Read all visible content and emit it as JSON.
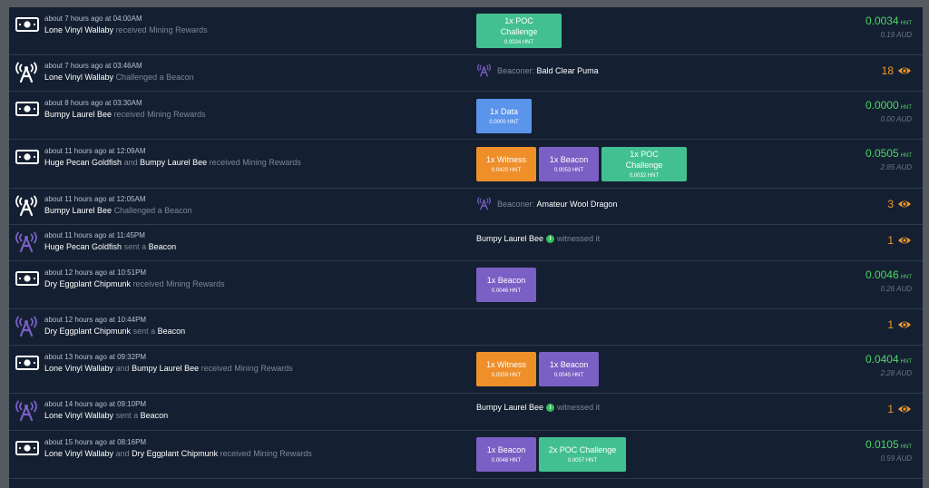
{
  "colors": {
    "poc": "#43c091",
    "data": "#5b94eb",
    "witness": "#ee8f2a",
    "beacon": "#7a5fc4",
    "hnt_green": "#4fd467",
    "count_orange": "#f0962a"
  },
  "rows": [
    {
      "time": "about 7 hours ago at 04:00AM",
      "name1": "Lone Vinyl Wallaby",
      "action": "received Mining Rewards",
      "chip1_title": "1x POC Challenge",
      "chip1_amount": "0.0034 HNT",
      "hnt": "0.0034",
      "unit": "HNT",
      "aud": "0.19 AUD"
    },
    {
      "time": "about 7 hours ago at 03:46AM",
      "name1": "Lone Vinyl Wallaby",
      "action": "Challenged a Beacon",
      "mid_label": "Beaconer:",
      "mid_name": "Bald Clear Puma",
      "count": "18"
    },
    {
      "time": "about 8 hours ago at 03:30AM",
      "name1": "Bumpy Laurel Bee",
      "action": "received Mining Rewards",
      "chip1_title": "1x Data",
      "chip1_amount": "0.0000 HNT",
      "hnt": "0.0000",
      "unit": "HNT",
      "aud": "0.00 AUD"
    },
    {
      "time": "about 11 hours ago at 12:09AM",
      "name1": "Huge Pecan Goldfish",
      "and": "and",
      "name2": "Bumpy Laurel Bee",
      "action": "received Mining Rewards",
      "chip1_title": "1x Witness",
      "chip1_amount": "0.0420 HNT",
      "chip2_title": "1x Beacon",
      "chip2_amount": "0.0053 HNT",
      "chip3_title": "1x POC Challenge",
      "chip3_amount": "0.0032 HNT",
      "hnt": "0.0505",
      "unit": "HNT",
      "aud": "2.85 AUD"
    },
    {
      "time": "about 11 hours ago at 12:05AM",
      "name1": "Bumpy Laurel Bee",
      "action": "Challenged a Beacon",
      "mid_label": "Beaconer:",
      "mid_name": "Amateur Wool Dragon",
      "count": "3"
    },
    {
      "time": "about 11 hours ago at 11:45PM",
      "name1": "Huge Pecan Goldfish",
      "action": "sent a",
      "target": "Beacon",
      "mid_name": "Bumpy Laurel Bee",
      "mid_after": "witnessed it",
      "info": "i",
      "count": "1"
    },
    {
      "time": "about 12 hours ago at 10:51PM",
      "name1": "Dry Eggplant Chipmunk",
      "action": "received Mining Rewards",
      "chip1_title": "1x Beacon",
      "chip1_amount": "0.0046 HNT",
      "hnt": "0.0046",
      "unit": "HNT",
      "aud": "0.26 AUD"
    },
    {
      "time": "about 12 hours ago at 10:44PM",
      "name1": "Dry Eggplant Chipmunk",
      "action": "sent a",
      "target": "Beacon",
      "count": "1"
    },
    {
      "time": "about 13 hours ago at 09:32PM",
      "name1": "Lone Vinyl Wallaby",
      "and": "and",
      "name2": "Bumpy Laurel Bee",
      "action": "received Mining Rewards",
      "chip1_title": "1x Witness",
      "chip1_amount": "0.0359 HNT",
      "chip2_title": "1x Beacon",
      "chip2_amount": "0.0045 HNT",
      "hnt": "0.0404",
      "unit": "HNT",
      "aud": "2.28 AUD"
    },
    {
      "time": "about 14 hours ago at 09:10PM",
      "name1": "Lone Vinyl Wallaby",
      "action": "sent a",
      "target": "Beacon",
      "mid_name": "Bumpy Laurel Bee",
      "mid_after": "witnessed it",
      "info": "i",
      "count": "1"
    },
    {
      "time": "about 15 hours ago at 08:16PM",
      "name1": "Lone Vinyl Wallaby",
      "and": "and",
      "name2": "Dry Eggplant Chipmunk",
      "action": "received Mining Rewards",
      "chip1_title": "1x Beacon",
      "chip1_amount": "0.0048 HNT",
      "chip2_title": "2x POC Challenge",
      "chip2_amount": "0.0057 HNT",
      "hnt": "0.0105",
      "unit": "HNT",
      "aud": "0.59 AUD"
    }
  ]
}
